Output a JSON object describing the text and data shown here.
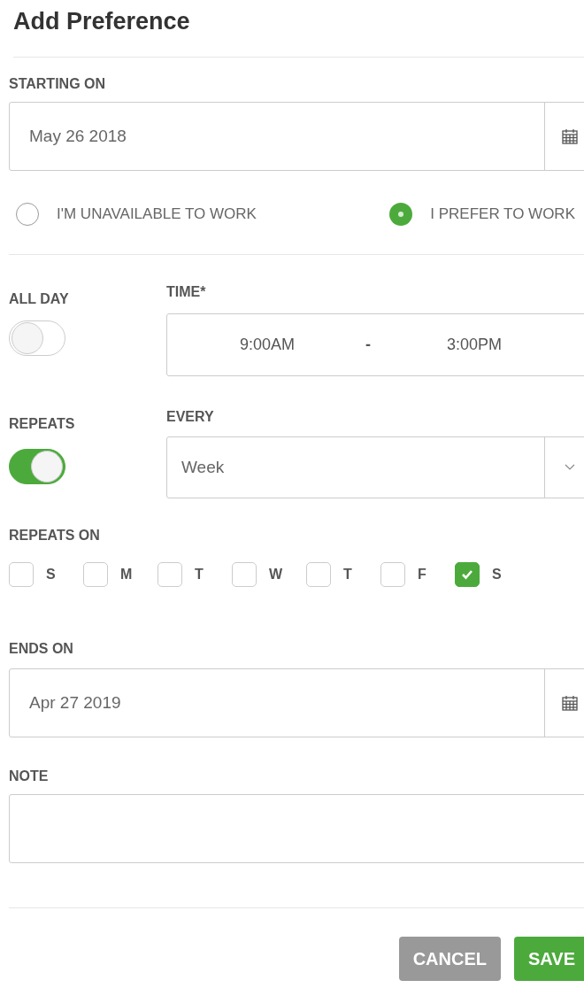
{
  "title": "Add Preference",
  "starting_on": {
    "label": "STARTING ON",
    "value": "May 26 2018"
  },
  "availability": [
    {
      "label": "I'M UNAVAILABLE TO WORK",
      "selected": false
    },
    {
      "label": "I PREFER TO WORK",
      "selected": true
    }
  ],
  "all_day": {
    "label": "ALL DAY",
    "on": false
  },
  "time": {
    "label": "TIME*",
    "start": "9:00AM",
    "separator": "-",
    "end": "3:00PM"
  },
  "repeats": {
    "label": "REPEATS",
    "on": true
  },
  "every": {
    "label": "EVERY",
    "value": "Week"
  },
  "repeats_on": {
    "label": "REPEATS ON",
    "days": [
      {
        "label": "S",
        "checked": false
      },
      {
        "label": "M",
        "checked": false
      },
      {
        "label": "T",
        "checked": false
      },
      {
        "label": "W",
        "checked": false
      },
      {
        "label": "T",
        "checked": false
      },
      {
        "label": "F",
        "checked": false
      },
      {
        "label": "S",
        "checked": true
      }
    ]
  },
  "ends_on": {
    "label": "ENDS ON",
    "value": "Apr 27 2019"
  },
  "note": {
    "label": "NOTE"
  },
  "buttons": [
    {
      "label": "CANCEL",
      "kind": "secondary"
    },
    {
      "label": "SAVE",
      "kind": "primary"
    }
  ]
}
